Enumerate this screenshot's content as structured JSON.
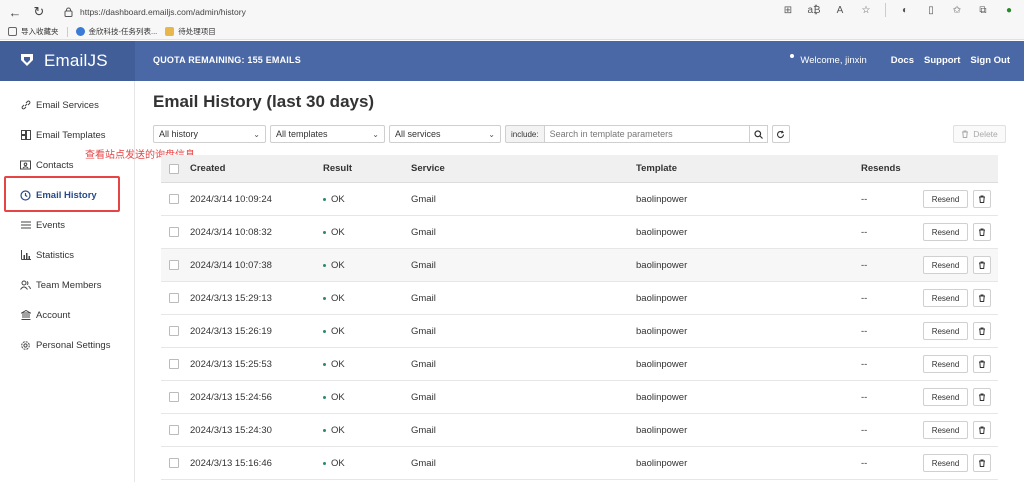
{
  "browser": {
    "url": "https://dashboard.emailjs.com/admin/history",
    "bookmarks": [
      "导入收藏夹",
      "金欣科技-任务列表...",
      "待处理项目"
    ]
  },
  "header": {
    "logo": "EmailJS",
    "quota": "QUOTA REMAINING: 155 EMAILS",
    "welcome": "Welcome, jinxin",
    "links": [
      "Docs",
      "Support",
      "Sign Out"
    ],
    "bg_color": "#4a68a5"
  },
  "sidebar": {
    "items": [
      {
        "label": "Email Services",
        "icon": "link-icon"
      },
      {
        "label": "Email Templates",
        "icon": "template-icon"
      },
      {
        "label": "Contacts",
        "icon": "contact-card-icon"
      },
      {
        "label": "Email History",
        "icon": "clock-icon",
        "active": true
      },
      {
        "label": "Events",
        "icon": "list-icon"
      },
      {
        "label": "Statistics",
        "icon": "bar-chart-icon"
      },
      {
        "label": "Team Members",
        "icon": "team-icon"
      },
      {
        "label": "Account",
        "icon": "bank-icon"
      },
      {
        "label": "Personal Settings",
        "icon": "gear-icon"
      }
    ]
  },
  "annotation": {
    "text": "查看站点发送的询盘信息",
    "color": "#e64545"
  },
  "main": {
    "title": "Email History (last 30 days)",
    "filters": {
      "history": "All history",
      "templates": "All templates",
      "services": "All services",
      "include_label": "include:",
      "search_placeholder": "Search in template parameters"
    },
    "delete_label": "Delete"
  },
  "table": {
    "columns": [
      "Created",
      "Result",
      "Service",
      "Template",
      "Resends"
    ],
    "resend_label": "Resend",
    "rows": [
      {
        "created": "2024/3/14 10:09:24",
        "result": "OK",
        "service": "Gmail",
        "template": "baolinpower",
        "resends": "--"
      },
      {
        "created": "2024/3/14 10:08:32",
        "result": "OK",
        "service": "Gmail",
        "template": "baolinpower",
        "resends": "--"
      },
      {
        "created": "2024/3/14 10:07:38",
        "result": "OK",
        "service": "Gmail",
        "template": "baolinpower",
        "resends": "--"
      },
      {
        "created": "2024/3/13 15:29:13",
        "result": "OK",
        "service": "Gmail",
        "template": "baolinpower",
        "resends": "--"
      },
      {
        "created": "2024/3/13 15:26:19",
        "result": "OK",
        "service": "Gmail",
        "template": "baolinpower",
        "resends": "--"
      },
      {
        "created": "2024/3/13 15:25:53",
        "result": "OK",
        "service": "Gmail",
        "template": "baolinpower",
        "resends": "--"
      },
      {
        "created": "2024/3/13 15:24:56",
        "result": "OK",
        "service": "Gmail",
        "template": "baolinpower",
        "resends": "--"
      },
      {
        "created": "2024/3/13 15:24:30",
        "result": "OK",
        "service": "Gmail",
        "template": "baolinpower",
        "resends": "--"
      },
      {
        "created": "2024/3/13 15:16:46",
        "result": "OK",
        "service": "Gmail",
        "template": "baolinpower",
        "resends": "--"
      }
    ]
  }
}
